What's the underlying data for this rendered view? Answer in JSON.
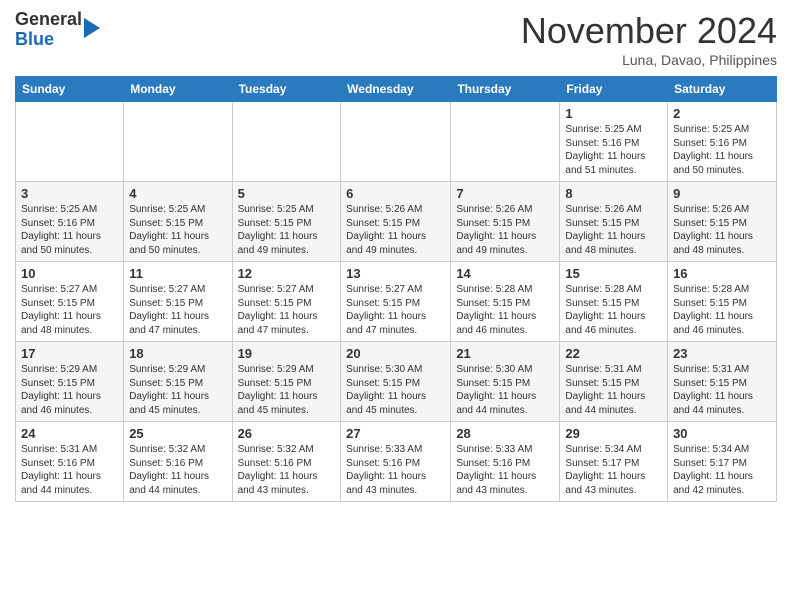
{
  "header": {
    "logo_line1": "General",
    "logo_line2": "Blue",
    "month": "November 2024",
    "location": "Luna, Davao, Philippines"
  },
  "weekdays": [
    "Sunday",
    "Monday",
    "Tuesday",
    "Wednesday",
    "Thursday",
    "Friday",
    "Saturday"
  ],
  "weeks": [
    [
      {
        "day": "",
        "text": ""
      },
      {
        "day": "",
        "text": ""
      },
      {
        "day": "",
        "text": ""
      },
      {
        "day": "",
        "text": ""
      },
      {
        "day": "",
        "text": ""
      },
      {
        "day": "1",
        "text": "Sunrise: 5:25 AM\nSunset: 5:16 PM\nDaylight: 11 hours\nand 51 minutes."
      },
      {
        "day": "2",
        "text": "Sunrise: 5:25 AM\nSunset: 5:16 PM\nDaylight: 11 hours\nand 50 minutes."
      }
    ],
    [
      {
        "day": "3",
        "text": "Sunrise: 5:25 AM\nSunset: 5:16 PM\nDaylight: 11 hours\nand 50 minutes."
      },
      {
        "day": "4",
        "text": "Sunrise: 5:25 AM\nSunset: 5:15 PM\nDaylight: 11 hours\nand 50 minutes."
      },
      {
        "day": "5",
        "text": "Sunrise: 5:25 AM\nSunset: 5:15 PM\nDaylight: 11 hours\nand 49 minutes."
      },
      {
        "day": "6",
        "text": "Sunrise: 5:26 AM\nSunset: 5:15 PM\nDaylight: 11 hours\nand 49 minutes."
      },
      {
        "day": "7",
        "text": "Sunrise: 5:26 AM\nSunset: 5:15 PM\nDaylight: 11 hours\nand 49 minutes."
      },
      {
        "day": "8",
        "text": "Sunrise: 5:26 AM\nSunset: 5:15 PM\nDaylight: 11 hours\nand 48 minutes."
      },
      {
        "day": "9",
        "text": "Sunrise: 5:26 AM\nSunset: 5:15 PM\nDaylight: 11 hours\nand 48 minutes."
      }
    ],
    [
      {
        "day": "10",
        "text": "Sunrise: 5:27 AM\nSunset: 5:15 PM\nDaylight: 11 hours\nand 48 minutes."
      },
      {
        "day": "11",
        "text": "Sunrise: 5:27 AM\nSunset: 5:15 PM\nDaylight: 11 hours\nand 47 minutes."
      },
      {
        "day": "12",
        "text": "Sunrise: 5:27 AM\nSunset: 5:15 PM\nDaylight: 11 hours\nand 47 minutes."
      },
      {
        "day": "13",
        "text": "Sunrise: 5:27 AM\nSunset: 5:15 PM\nDaylight: 11 hours\nand 47 minutes."
      },
      {
        "day": "14",
        "text": "Sunrise: 5:28 AM\nSunset: 5:15 PM\nDaylight: 11 hours\nand 46 minutes."
      },
      {
        "day": "15",
        "text": "Sunrise: 5:28 AM\nSunset: 5:15 PM\nDaylight: 11 hours\nand 46 minutes."
      },
      {
        "day": "16",
        "text": "Sunrise: 5:28 AM\nSunset: 5:15 PM\nDaylight: 11 hours\nand 46 minutes."
      }
    ],
    [
      {
        "day": "17",
        "text": "Sunrise: 5:29 AM\nSunset: 5:15 PM\nDaylight: 11 hours\nand 46 minutes."
      },
      {
        "day": "18",
        "text": "Sunrise: 5:29 AM\nSunset: 5:15 PM\nDaylight: 11 hours\nand 45 minutes."
      },
      {
        "day": "19",
        "text": "Sunrise: 5:29 AM\nSunset: 5:15 PM\nDaylight: 11 hours\nand 45 minutes."
      },
      {
        "day": "20",
        "text": "Sunrise: 5:30 AM\nSunset: 5:15 PM\nDaylight: 11 hours\nand 45 minutes."
      },
      {
        "day": "21",
        "text": "Sunrise: 5:30 AM\nSunset: 5:15 PM\nDaylight: 11 hours\nand 44 minutes."
      },
      {
        "day": "22",
        "text": "Sunrise: 5:31 AM\nSunset: 5:15 PM\nDaylight: 11 hours\nand 44 minutes."
      },
      {
        "day": "23",
        "text": "Sunrise: 5:31 AM\nSunset: 5:15 PM\nDaylight: 11 hours\nand 44 minutes."
      }
    ],
    [
      {
        "day": "24",
        "text": "Sunrise: 5:31 AM\nSunset: 5:16 PM\nDaylight: 11 hours\nand 44 minutes."
      },
      {
        "day": "25",
        "text": "Sunrise: 5:32 AM\nSunset: 5:16 PM\nDaylight: 11 hours\nand 44 minutes."
      },
      {
        "day": "26",
        "text": "Sunrise: 5:32 AM\nSunset: 5:16 PM\nDaylight: 11 hours\nand 43 minutes."
      },
      {
        "day": "27",
        "text": "Sunrise: 5:33 AM\nSunset: 5:16 PM\nDaylight: 11 hours\nand 43 minutes."
      },
      {
        "day": "28",
        "text": "Sunrise: 5:33 AM\nSunset: 5:16 PM\nDaylight: 11 hours\nand 43 minutes."
      },
      {
        "day": "29",
        "text": "Sunrise: 5:34 AM\nSunset: 5:17 PM\nDaylight: 11 hours\nand 43 minutes."
      },
      {
        "day": "30",
        "text": "Sunrise: 5:34 AM\nSunset: 5:17 PM\nDaylight: 11 hours\nand 42 minutes."
      }
    ]
  ]
}
